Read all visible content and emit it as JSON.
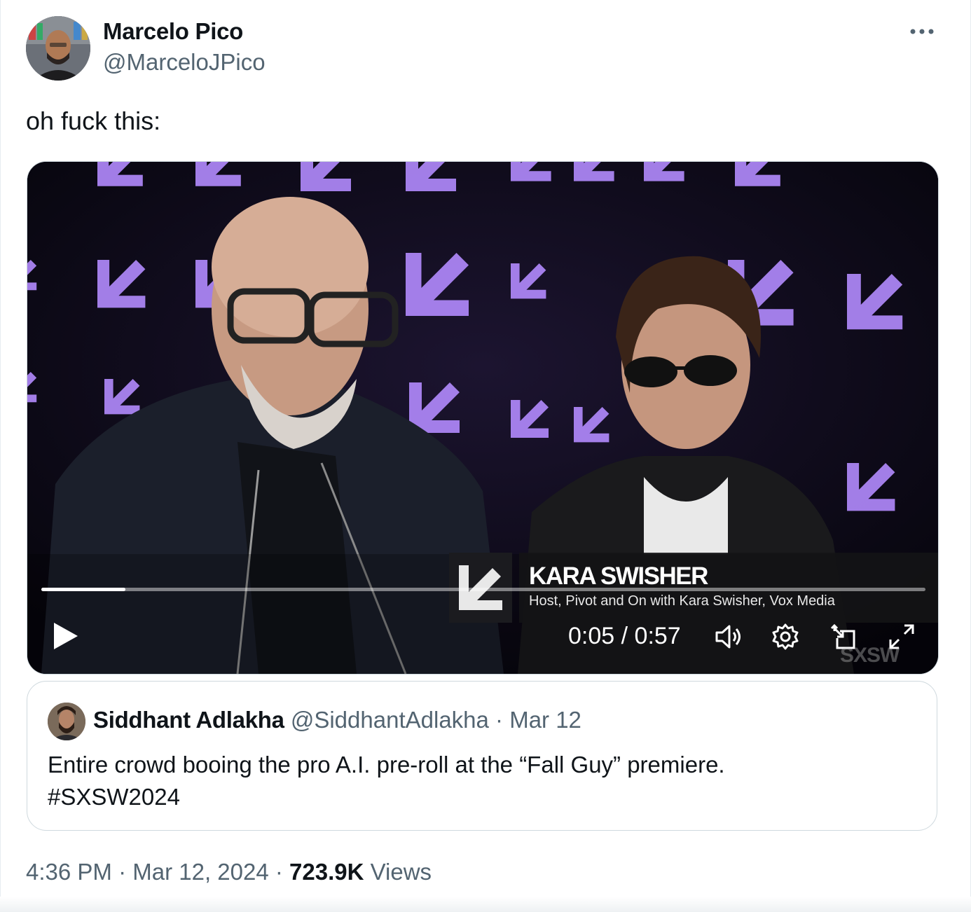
{
  "author": {
    "name": "Marcelo Pico",
    "handle": "@MarceloJPico"
  },
  "tweet": {
    "text": "oh fuck this:"
  },
  "video": {
    "lower_third_name": "KARA SWISHER",
    "lower_third_title": "Host, Pivot and On with Kara Swisher, Vox Media",
    "current_time": "0:05",
    "time_separator": " / ",
    "duration": "0:57",
    "progress": 0.095,
    "watermark": "SXSW",
    "controls": [
      "play-icon",
      "volume-icon",
      "settings-gear-icon",
      "picture-in-picture-icon",
      "fullscreen-icon"
    ]
  },
  "quoted_tweet": {
    "name": "Siddhant Adlakha",
    "handle": "@SiddhantAdlakha",
    "separator": " · ",
    "date": "Mar 12",
    "text_line1": "Entire crowd booing the pro A.I. pre-roll at the “Fall Guy” premiere.",
    "text_line2": "#SXSW2024"
  },
  "footer": {
    "time": "4:36 PM",
    "sep1": " · ",
    "date": "Mar 12, 2024",
    "sep2": " · ",
    "views_count": "723.9K",
    "views_label": " Views"
  },
  "colors": {
    "text_primary": "#0f1419",
    "text_secondary": "#536471",
    "border": "#cfd9de",
    "backdrop_glyph": "#b48cff"
  }
}
